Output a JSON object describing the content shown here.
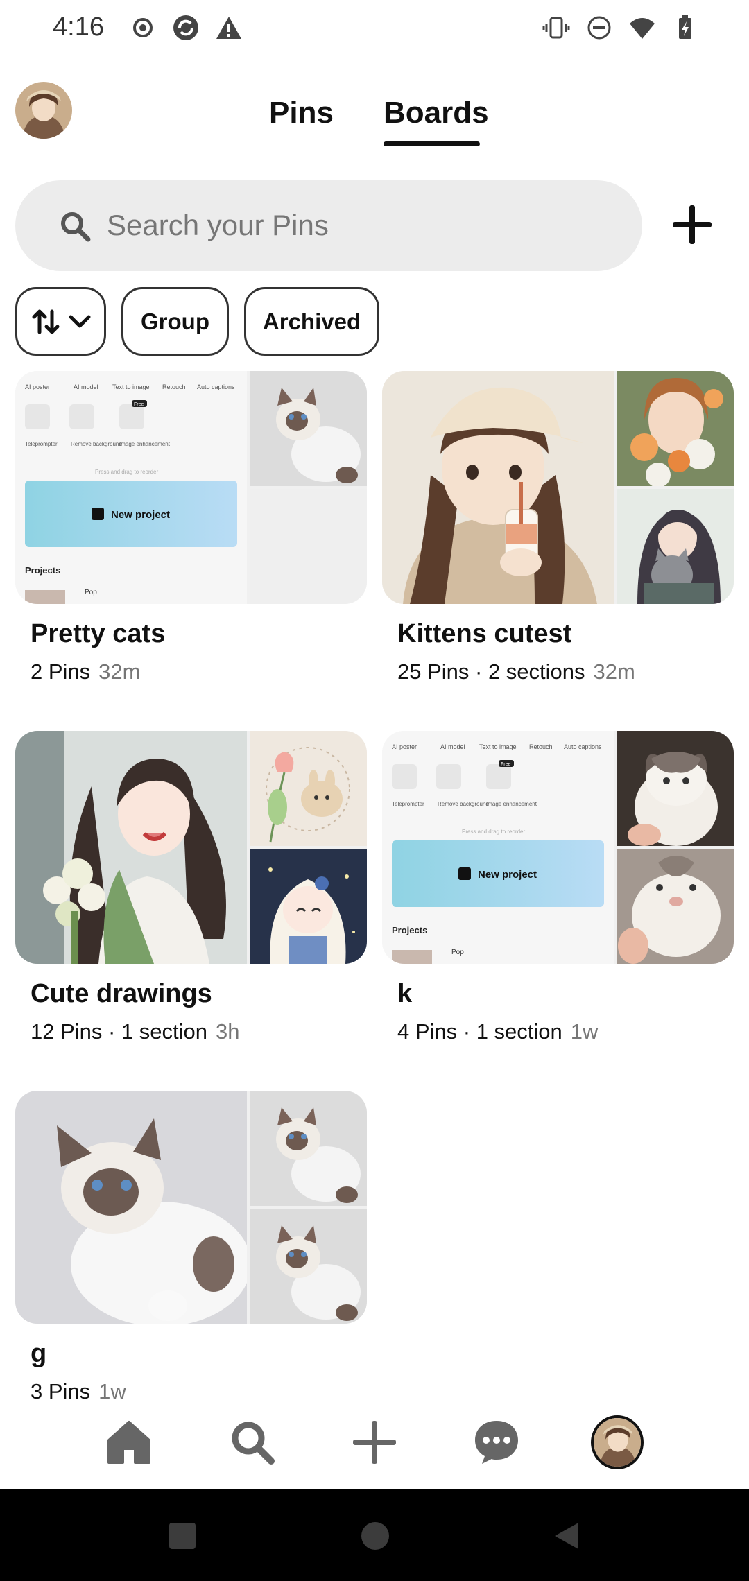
{
  "status_bar": {
    "time": "4:16",
    "left_icons": [
      "record-icon",
      "sync-icon",
      "alert-icon"
    ],
    "right_icons": [
      "vibrate-icon",
      "dnd-icon",
      "wifi-icon",
      "battery-charging-icon"
    ]
  },
  "tabs": [
    {
      "label": "Pins",
      "active": false
    },
    {
      "label": "Boards",
      "active": true
    }
  ],
  "search": {
    "placeholder": "Search your Pins",
    "value": ""
  },
  "filters": {
    "sort_icon": "sort-icon",
    "group_label": "Group",
    "archived_label": "Archived"
  },
  "boards": [
    {
      "title": "Pretty cats",
      "meta": "2 Pins",
      "time": "32m"
    },
    {
      "title": "Kittens cutest",
      "meta": "25 Pins · 2 sections",
      "time": "32m"
    },
    {
      "title": "Cute drawings",
      "meta": "12 Pins · 1 section",
      "time": "3h"
    },
    {
      "title": "k",
      "meta": "4 Pins · 1 section",
      "time": "1w"
    },
    {
      "title": "g",
      "meta": "3 Pins",
      "time": "1w"
    }
  ],
  "app_mock": {
    "tools": [
      "AI poster",
      "AI model",
      "Text to image",
      "Retouch",
      "Auto captions"
    ],
    "tools2": [
      "Teleprompter",
      "Remove background",
      "Image enhancement"
    ],
    "free_badge": "Free",
    "hint": "Press and drag to reorder",
    "new_project": "New project",
    "projects": "Projects",
    "pop": "Pop"
  },
  "bottom_nav": [
    "home-icon",
    "search-icon",
    "create-icon",
    "messages-icon",
    "profile-avatar"
  ],
  "colors": {
    "background": "#ffffff",
    "search_bg": "#ececec",
    "text_primary": "#111111",
    "text_secondary": "#767676",
    "system_nav": "#000000"
  }
}
